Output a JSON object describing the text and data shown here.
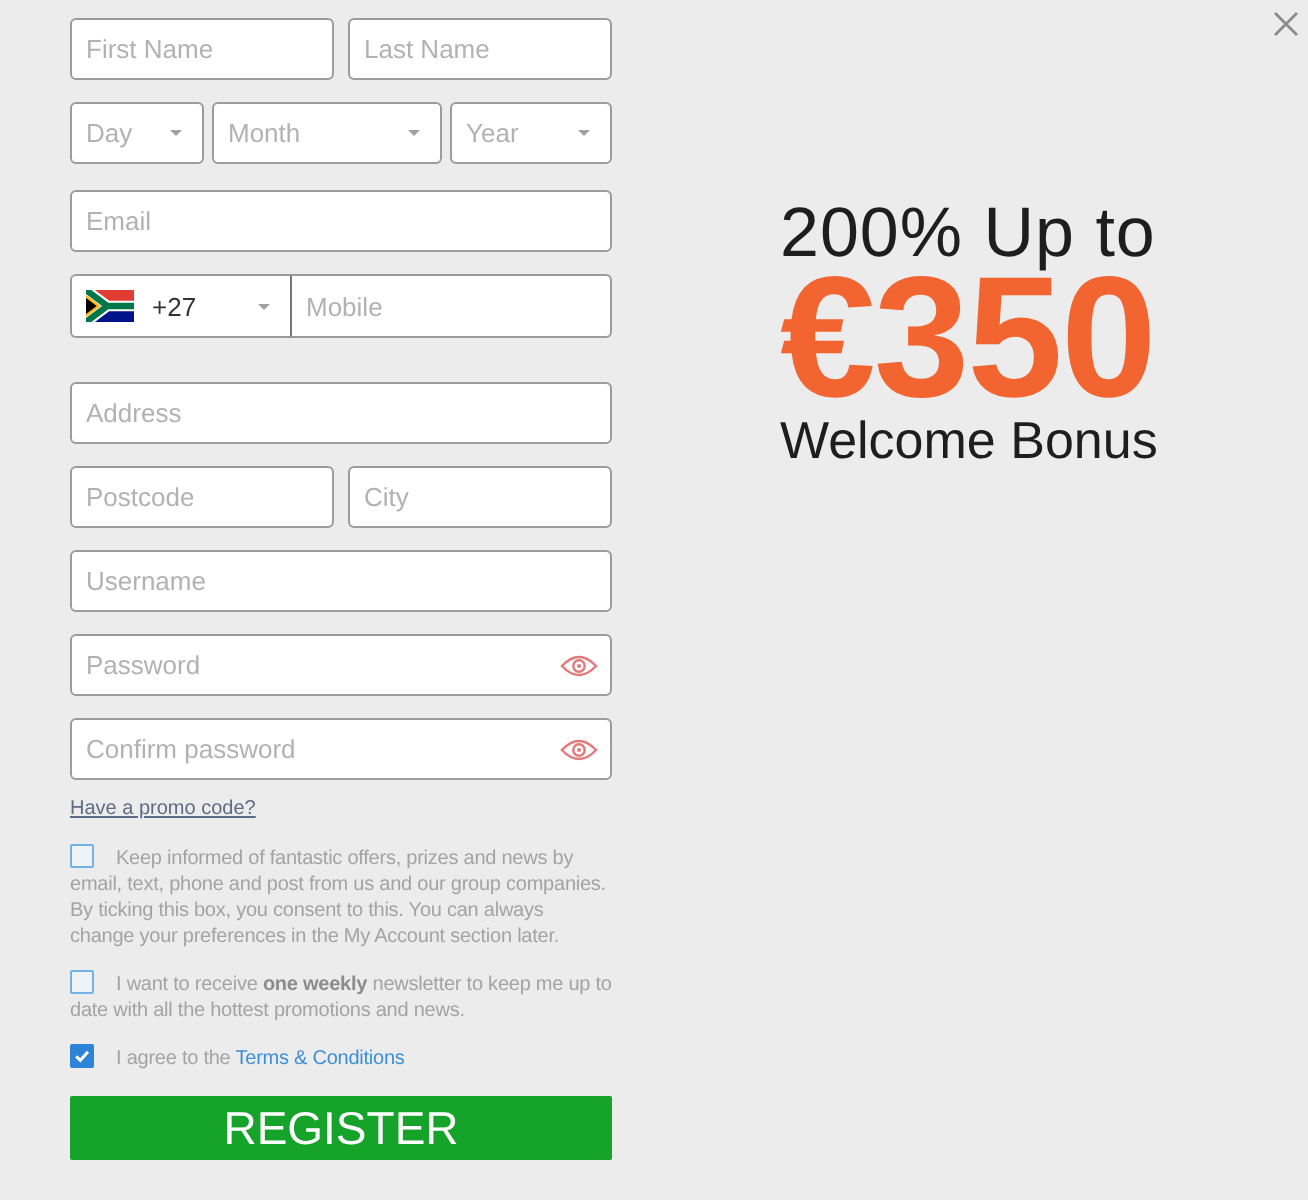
{
  "form": {
    "name_fields": [
      {
        "placeholder": "First Name"
      },
      {
        "placeholder": "Last Name"
      }
    ],
    "birth_date": [
      {
        "placeholder": "Day"
      },
      {
        "placeholder": "Month"
      },
      {
        "placeholder": "Year"
      }
    ],
    "email": {
      "placeholder": "Email"
    },
    "phone": {
      "country_code": "+27",
      "placeholder": "Mobile"
    },
    "address": {
      "placeholder": "Address"
    },
    "postcode_city": [
      {
        "placeholder": "Postcode"
      },
      {
        "placeholder": "City"
      }
    ],
    "username": {
      "placeholder": "Username"
    },
    "passwords": [
      {
        "placeholder": "Password"
      },
      {
        "placeholder": "Confirm password"
      }
    ],
    "promo_link": "Have a promo code?",
    "consents": [
      {
        "text": "Keep informed of fantastic offers, prizes and news by email, text, phone and post from us and our group companies. By ticking this box, you consent to this. You can always change your preferences in the My Account section later.",
        "checked": false
      },
      {
        "text": "I want to receive **one weekly** newsletter to keep me up to date with all the hottest promotions and news.",
        "checked": false
      },
      {
        "text": "I agree to the",
        "link": "Terms & Conditions",
        "checked": true
      }
    ],
    "submit": "REGISTER"
  },
  "promo": {
    "headline": "200% Up to",
    "amount": "€350",
    "subtitle": "Welcome Bonus"
  }
}
